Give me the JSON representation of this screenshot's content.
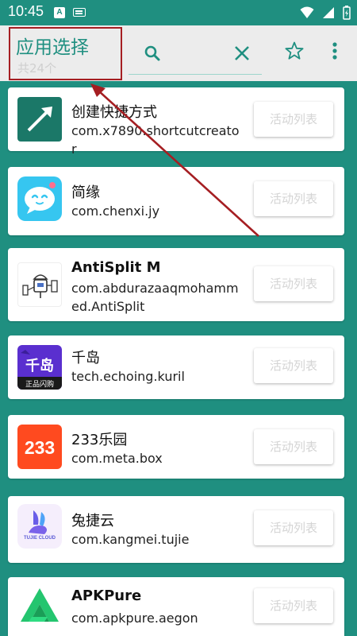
{
  "status_bar": {
    "time": "10:45",
    "input_indicator": "A"
  },
  "app_bar": {
    "title": "应用选择",
    "subtitle": "共24个"
  },
  "apps": [
    {
      "name": "创建快捷方式",
      "package": "com.x7890.shortcutcreator",
      "button": "活动列表",
      "icon": "shortcut-arrow-icon"
    },
    {
      "name": "简缘",
      "package": "com.chenxi.jy",
      "button": "活动列表",
      "icon": "chat-bubble-face-icon"
    },
    {
      "name": "AntiSplit M",
      "package": "com.abdurazaaqmohammed.AntiSplit",
      "button": "活动列表",
      "icon": "android-robot-icon"
    },
    {
      "name": "千岛",
      "package": "tech.echoing.kuril",
      "button": "活动列表",
      "icon": "qiandao-logo-icon",
      "icon_text": "正品闪购"
    },
    {
      "name": "233乐园",
      "package": "com.meta.box",
      "button": "活动列表",
      "icon": "233-logo-icon",
      "icon_text": "233"
    },
    {
      "name": "兔捷云",
      "package": "com.kangmei.tujie",
      "button": "活动列表",
      "icon": "tujie-rabbit-icon",
      "icon_text": "TUJIE CLOUD"
    },
    {
      "name": "APKPure",
      "package": "com.apkpure.aegon",
      "button": "活动列表",
      "icon": "apkpure-logo-icon"
    }
  ],
  "colors": {
    "primary": "#1f8f80",
    "appbar_bg": "#ececec",
    "annotation_red": "#a51e22",
    "button_text": "#d4d4d4"
  }
}
